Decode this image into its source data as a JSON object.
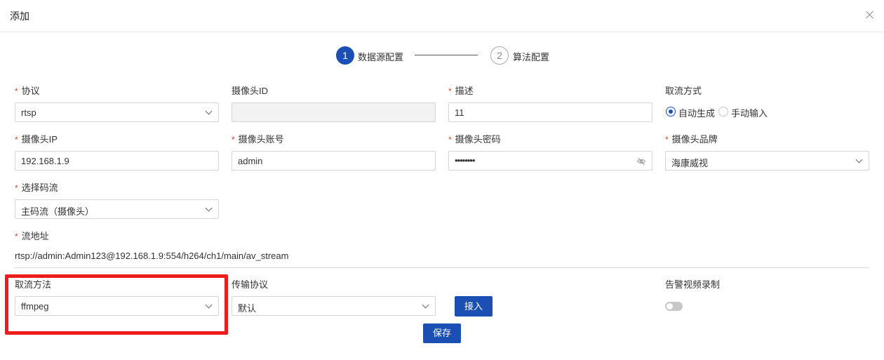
{
  "dialog": {
    "title": "添加"
  },
  "steps": [
    {
      "number": "1",
      "label": "数据源配置"
    },
    {
      "number": "2",
      "label": "算法配置"
    }
  ],
  "form": {
    "protocol": {
      "label": "协议",
      "value": "rtsp"
    },
    "camera_id": {
      "label": "摄像头ID",
      "value": ""
    },
    "description": {
      "label": "描述",
      "value": "11"
    },
    "stream_mode": {
      "label": "取流方式",
      "options": [
        "自动生成",
        "手动输入"
      ],
      "selected": "自动生成"
    },
    "camera_ip": {
      "label": "摄像头IP",
      "value": "192.168.1.9"
    },
    "camera_account": {
      "label": "摄像头账号",
      "value": "admin"
    },
    "camera_password": {
      "label": "摄像头密码",
      "value": "••••••••"
    },
    "camera_brand": {
      "label": "摄像头品牌",
      "value": "海康威视"
    },
    "stream_select": {
      "label": "选择码流",
      "value": "主码流（摄像头）"
    },
    "stream_url": {
      "label": "流地址",
      "value": "rtsp://admin:Admin123@192.168.1.9:554/h264/ch1/main/av_stream"
    },
    "fetch_method": {
      "label": "取流方法",
      "value": "ffmpeg"
    },
    "transport": {
      "label": "传输协议",
      "value": "默认"
    },
    "alarm_record": {
      "label": "告警视频录制",
      "enabled": false
    }
  },
  "buttons": {
    "connect": "接入",
    "save": "保存"
  },
  "colors": {
    "primary": "#1b4fb3",
    "required": "#e0452b",
    "highlight": "#ee1c1c"
  },
  "icons": {
    "close": "close-icon",
    "select": "chevron-down-icon",
    "password": "eye-off-icon"
  }
}
